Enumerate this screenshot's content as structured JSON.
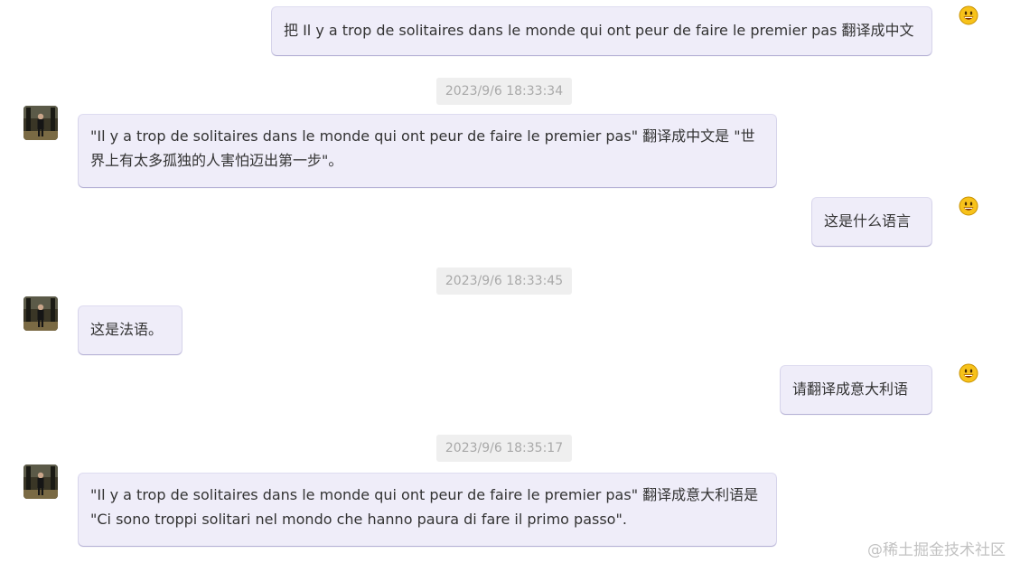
{
  "messages": [
    {
      "role": "user",
      "text": "把 Il y a trop de solitaires dans le monde qui ont peur de faire le premier pas 翻译成中文"
    },
    {
      "role": "assistant",
      "timestamp": "2023/9/6 18:33:34",
      "text": "\"Il y a trop de solitaires dans le monde qui ont peur de faire le premier pas\" 翻译成中文是 \"世界上有太多孤独的人害怕迈出第一步\"。"
    },
    {
      "role": "user",
      "text": "这是什么语言"
    },
    {
      "role": "assistant",
      "timestamp": "2023/9/6 18:33:45",
      "text": "这是法语。"
    },
    {
      "role": "user",
      "text": "请翻译成意大利语"
    },
    {
      "role": "assistant",
      "timestamp": "2023/9/6 18:35:17",
      "text": "\"Il y a trop de solitaires dans le monde qui ont peur de faire le premier pas\" 翻译成意大利语是 \"Ci sono troppi solitari nel mondo che hanno paura di fare il primo passo\"."
    }
  ],
  "icons": {
    "user": "smiley-emoji-icon",
    "assistant": "assistant-avatar"
  },
  "watermark": "@稀土掘金技术社区",
  "colors": {
    "bubble": "#efedf9",
    "timestamp_bg": "#efefef",
    "timestamp_text": "#a9a9a9"
  }
}
